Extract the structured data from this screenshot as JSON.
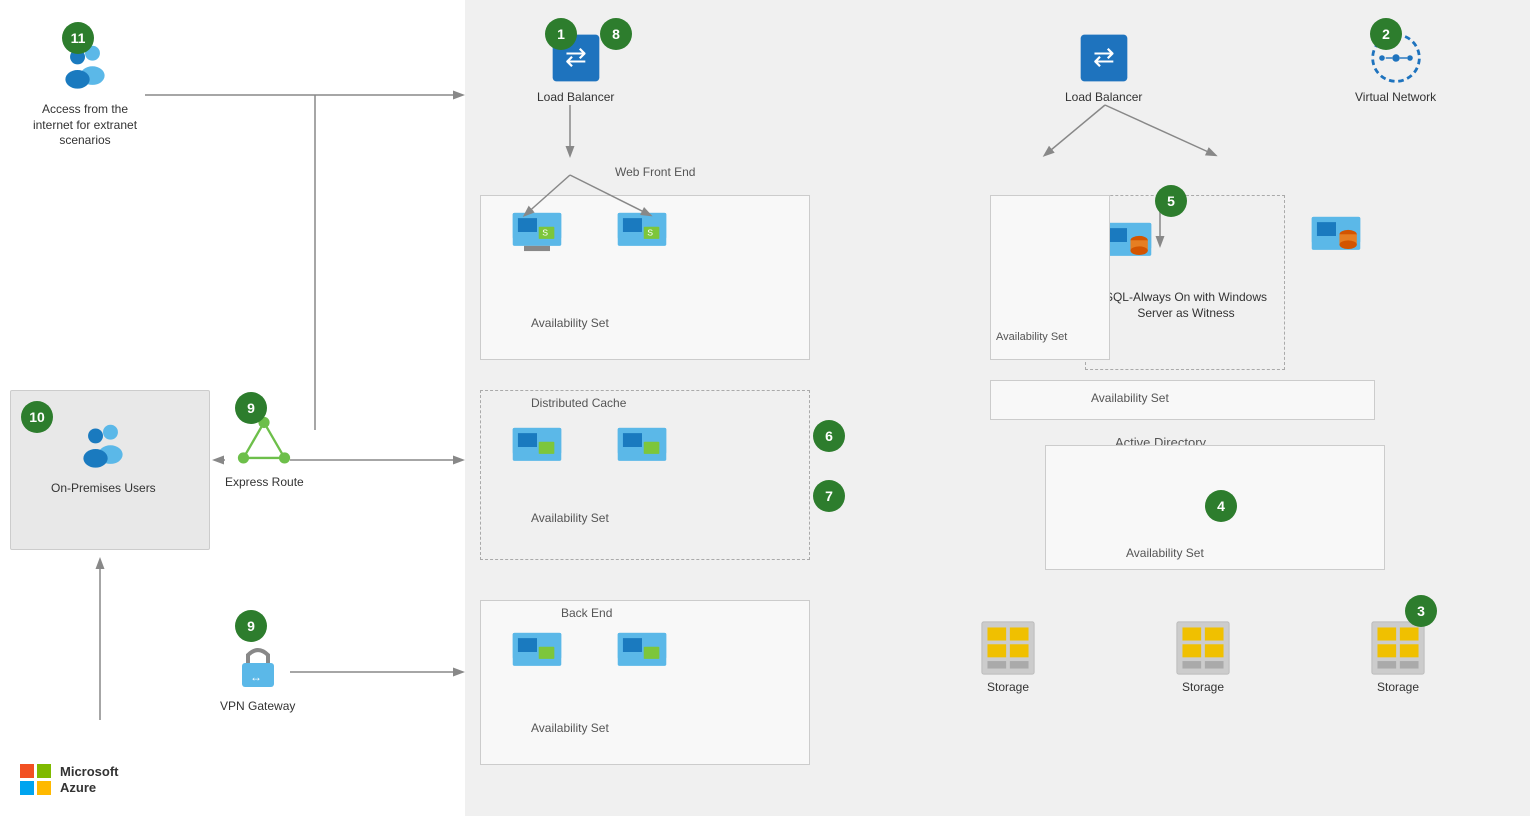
{
  "circles": {
    "c1": "1",
    "c2": "2",
    "c3": "3",
    "c4": "4",
    "c5": "5",
    "c6": "6",
    "c7": "7",
    "c8": "8",
    "c9a": "9",
    "c9b": "9",
    "c10": "10",
    "c11": "11"
  },
  "labels": {
    "access_internet": "Access from the\ninternet for extranet\nscenarios",
    "load_balancer_1": "Load Balancer",
    "load_balancer_2": "Load Balancer",
    "virtual_network": "Virtual Network",
    "web_front_end": "Web Front End",
    "avail_set_1": "Availability Set",
    "avail_set_2": "Availability Set",
    "avail_set_3": "Availability Set",
    "avail_set_4": "Availability Set",
    "avail_set_5": "Availability Set",
    "distributed_cache": "Distributed Cache",
    "back_end": "Back End",
    "sql_always_on": "SQL-Always On\nwith Windows Server\nas Witness",
    "active_directory": "Active Directory",
    "storage_1": "Storage",
    "storage_2": "Storage",
    "storage_3": "Storage",
    "on_premises_users": "On-Premises Users",
    "express_route": "Express Route",
    "vpn_gateway": "VPN Gateway",
    "microsoft": "Microsoft",
    "azure": "Azure"
  }
}
